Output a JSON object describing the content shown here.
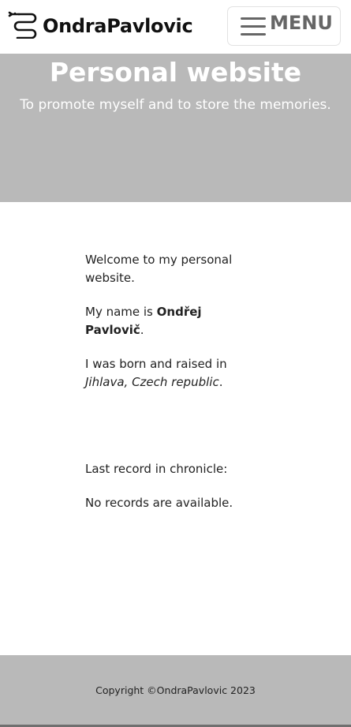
{
  "navbar": {
    "brand_name": "OndraPavlovic",
    "brand_icon": "snake-logo-icon",
    "menu_label": "MENU",
    "menu_icon": "hamburger-icon"
  },
  "hero": {
    "title": "Personal website",
    "subtitle": "To promote myself and to store the memories.",
    "background_color": "#b9b9b9"
  },
  "content": {
    "welcome": "Welcome to my personal website.",
    "name_prefix": "My name is ",
    "name": "Ondřej Pavlovič",
    "name_suffix": ".",
    "born_prefix": "I was born and raised in ",
    "born_place": "Jihlava, Czech republic",
    "born_suffix": ".",
    "chronicle_label": "Last record in chronicle:",
    "chronicle_empty": "No records are available."
  },
  "footer": {
    "copyright": "Copyright ©OndraPavlovic 2023"
  }
}
